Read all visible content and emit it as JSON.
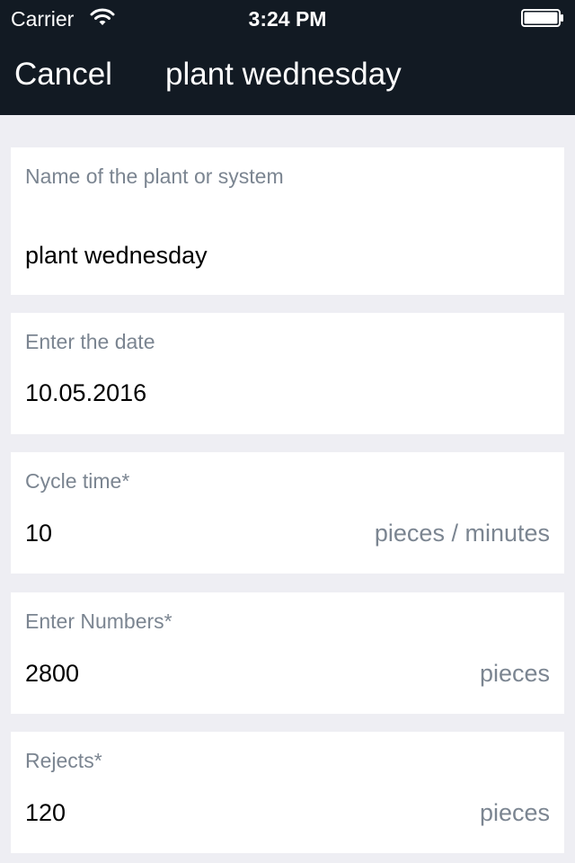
{
  "status_bar": {
    "carrier": "Carrier",
    "time": "3:24 PM",
    "wifi_icon": "wifi-icon",
    "battery_icon": "battery-icon"
  },
  "nav": {
    "cancel_label": "Cancel",
    "title": "plant wednesday"
  },
  "colors": {
    "header_bg": "#121a23",
    "page_bg": "#eeeef3",
    "label_color": "#7b8591"
  },
  "form": {
    "plant_name": {
      "label": "Name of the plant or system",
      "value": "plant wednesday"
    },
    "date": {
      "label": "Enter the date",
      "value": "10.05.2016"
    },
    "cycle_time": {
      "label": "Cycle time*",
      "value": "10",
      "unit": "pieces / minutes"
    },
    "numbers": {
      "label": "Enter Numbers*",
      "value": "2800",
      "unit": "pieces"
    },
    "rejects": {
      "label": "Rejects*",
      "value": "120",
      "unit": "pieces"
    }
  }
}
